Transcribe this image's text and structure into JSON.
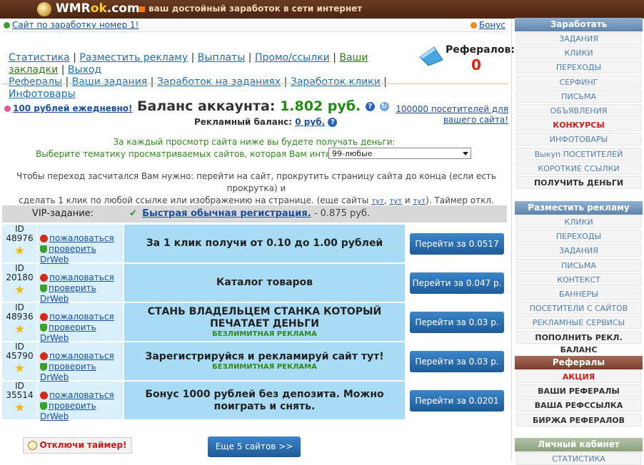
{
  "header": {
    "logo_main": "WMR",
    "logo_ok": "ok",
    "logo_tld": ".com",
    "slogan": "ваш достойный заработок в сети интернет"
  },
  "infobar": {
    "site_best": "Сайт по заработку номер 1!",
    "bonus": "Бонус"
  },
  "nav": {
    "items": [
      "Статистика",
      "Разместить рекламу",
      "Выплаты",
      "Промо/ссылки",
      "Ваши закладки",
      "Выход",
      "Рефералы",
      "Ваши задания",
      "Заработок на заданиях",
      "Заработок клики",
      "Инфотовары"
    ]
  },
  "referrals": {
    "label": "Рефералов:",
    "count": "0"
  },
  "balance": {
    "daily_link": "100 рублей ежедневно!",
    "label": "Баланс аккаунта:",
    "value": "1.802 руб.",
    "ad_label": "Рекламный баланс:",
    "ad_value": "0 руб.",
    "visitors_line1": "100000 посетителей для",
    "visitors_line2": "вашего сайта!"
  },
  "instructions": {
    "line1": "За каждый просмотр сайта ниже вы будете получать деньги:",
    "line2": "Выберите тематику просматриваемых сайтов, которая Вам интересна:",
    "theme_selected": "99-любые",
    "line3": "Чтобы переход засчитался Вам нужно: перейти на сайт, прокрутить страницу сайта до конца (если есть прокрутка) и",
    "line4a": "сделать 1 клик по любой ссылке или изображению на странице. (еще сайты",
    "line4b": "и",
    "line4c": "). Таймер откл.",
    "tut": "тут",
    "dot": "."
  },
  "table": {
    "vip_label": "VIP-задание:",
    "quick_link": "Быстрая обычная регистрация.",
    "quick_price": "- 0.875 руб.",
    "complain": "пожаловаться",
    "check_drweb": "проверить DrWeb",
    "id_label": "ID",
    "unlimited": "БЕЗЛИМИТНАЯ РЕКЛАМА",
    "rows": [
      {
        "id": "48976",
        "title": "За 1 клик получи от 0.10 до 1.00 рублей",
        "sub": "",
        "button": "Перейти за 0.0517"
      },
      {
        "id": "20180",
        "title": "Каталог товаров",
        "sub": "",
        "button": "Перейти за 0.047 р."
      },
      {
        "id": "48936",
        "title": "СТАНЬ ВЛАДЕЛЬЦЕМ СТАНКА КОТОРЫЙ ПЕЧАТАЕТ ДЕНЬГИ",
        "sub": "БЕЗЛИМИТНАЯ РЕКЛАМА",
        "button": "Перейти за 0.03 р."
      },
      {
        "id": "45790",
        "title": "Зарегистрируйся и рекламируй сайт тут!",
        "sub": "БЕЗЛИМИТНАЯ РЕКЛАМА",
        "button": "Перейти за 0.03 р."
      },
      {
        "id": "35514",
        "title": "Бонус 1000 рублей без депозита. Можно поиграть и снять.",
        "sub": "",
        "button": "Перейти за 0.0201"
      }
    ]
  },
  "footer": {
    "timer_off": "Отключи таймер!",
    "more_sites": "Еще 5 сайтов >>"
  },
  "sidebar": {
    "earn": {
      "title": "Заработать",
      "items": [
        "ЗАДАНИЯ",
        "КЛИКИ",
        "ПЕРЕХОДЫ",
        "СЕРФИНГ",
        "ПИСЬМА",
        "ОБЪЯВЛЕНИЯ",
        "КОНКУРСЫ",
        "ИНФОТОВАРЫ",
        "Выкуп ПОСЕТИТЕЛЕЙ",
        "КОРОТКИЕ ССЫЛКИ",
        "ПОЛУЧИТЬ ДЕНЬГИ"
      ]
    },
    "advertise": {
      "title": "Разместить рекламу",
      "items": [
        "КЛИКИ",
        "ПЕРЕХОДЫ",
        "ЗАДАНИЯ",
        "ПИСЬМА",
        "КОНТЕКСТ",
        "БАННЕРЫ",
        "ПОСЕТИТЕЛИ С САЙТОВ",
        "РЕКЛАМНЫЕ СЕРВИСЫ",
        "ПОПОЛНИТЬ РЕКЛ. БАЛАНС"
      ]
    },
    "referrals": {
      "title": "Рефералы",
      "items": [
        "АКЦИЯ",
        "ВАШИ РЕФЕРАЛЫ",
        "ВАША РЕФССЫЛКА",
        "БИРЖА РЕФЕРАЛОВ"
      ]
    },
    "cabinet": {
      "title": "Личный кабинет",
      "items": [
        "СТАТИСТИКА"
      ]
    }
  },
  "colors": {
    "header_brown": "#4b2412",
    "link_blue": "#1a4fa0",
    "balance_green": "#218a15",
    "referral_red": "#e2230b",
    "row_light": "#d9f0fa",
    "row_title": "#a9dcf4",
    "button_blue": "#1d5a99"
  }
}
